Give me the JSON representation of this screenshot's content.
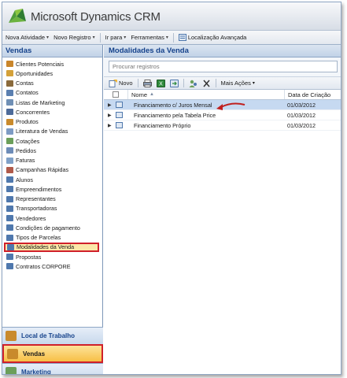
{
  "app": {
    "title": "Microsoft Dynamics CRM"
  },
  "menubar": {
    "items": [
      {
        "label": "Nova Atividade",
        "has_dropdown": true
      },
      {
        "label": "Novo Registro",
        "has_dropdown": true
      },
      {
        "label": "Ir para",
        "has_dropdown": true
      },
      {
        "label": "Ferramentas",
        "has_dropdown": true
      },
      {
        "label": "Localização Avançada",
        "has_dropdown": false
      }
    ]
  },
  "leftnav": {
    "header": "Vendas",
    "items": [
      {
        "label": "Clientes Potenciais",
        "icon": "leads-icon",
        "color": "#c9862c"
      },
      {
        "label": "Oportunidades",
        "icon": "opportunities-icon",
        "color": "#d4a13a"
      },
      {
        "label": "Contas",
        "icon": "accounts-icon",
        "color": "#8a6a3c"
      },
      {
        "label": "Contatos",
        "icon": "contacts-icon",
        "color": "#5a7fb0"
      },
      {
        "label": "Listas de Marketing",
        "icon": "marketing-lists-icon",
        "color": "#6f8fb5"
      },
      {
        "label": "Concorrentes",
        "icon": "competitors-icon",
        "color": "#4d6b9a"
      },
      {
        "label": "Produtos",
        "icon": "products-icon",
        "color": "#c98a2c"
      },
      {
        "label": "Literatura de Vendas",
        "icon": "sales-literature-icon",
        "color": "#7d9bc4"
      },
      {
        "label": "Cotações",
        "icon": "quotes-icon",
        "color": "#6b9f5a"
      },
      {
        "label": "Pedidos",
        "icon": "orders-icon",
        "color": "#6d8cb8"
      },
      {
        "label": "Faturas",
        "icon": "invoices-icon",
        "color": "#7fa0c7"
      },
      {
        "label": "Campanhas Rápidas",
        "icon": "quick-campaigns-icon",
        "color": "#b05a4a"
      },
      {
        "label": "Alunos",
        "icon": "students-icon",
        "color": "#4f78ad"
      },
      {
        "label": "Empreendimentos",
        "icon": "ventures-icon",
        "color": "#4f78ad"
      },
      {
        "label": "Representantes",
        "icon": "representatives-icon",
        "color": "#4f78ad"
      },
      {
        "label": "Transportadoras",
        "icon": "carriers-icon",
        "color": "#4f78ad"
      },
      {
        "label": "Vendedores",
        "icon": "sellers-icon",
        "color": "#4f78ad"
      },
      {
        "label": "Condições de pagamento",
        "icon": "payment-terms-icon",
        "color": "#4f78ad"
      },
      {
        "label": "Tipos de Parcelas",
        "icon": "installment-types-icon",
        "color": "#4f78ad"
      },
      {
        "label": "Modalidades da Venda",
        "icon": "sale-modalities-icon",
        "color": "#4f78ad",
        "selected": true
      },
      {
        "label": "Propostas",
        "icon": "proposals-icon",
        "color": "#4f78ad"
      },
      {
        "label": "Contratos CORPORE",
        "icon": "contracts-icon",
        "color": "#4f78ad"
      }
    ]
  },
  "wunderbar": {
    "items": [
      {
        "label": "Local de Trabalho",
        "icon": "workplace-icon",
        "color": "#c98a2c"
      },
      {
        "label": "Vendas",
        "icon": "sales-icon",
        "color": "#c98a2c",
        "active": true
      },
      {
        "label": "Marketing",
        "icon": "marketing-icon",
        "color": "#6b9f5a"
      }
    ]
  },
  "content": {
    "title": "Modalidades da Venda",
    "search": {
      "placeholder": "Procurar registros"
    },
    "toolbar": {
      "new_label": "Novo",
      "more_actions_label": "Mais Ações"
    },
    "columns": {
      "name": "Nome",
      "date": "Data de Criação"
    },
    "rows": [
      {
        "name": "Financiamento c/ Juros Mensal",
        "date": "01/03/2012",
        "selected": true
      },
      {
        "name": "Financiamento pela Tabela Price",
        "date": "01/03/2012",
        "selected": false
      },
      {
        "name": "Financiamento Próprio",
        "date": "01/03/2012",
        "selected": false
      }
    ]
  },
  "colors": {
    "brand_blue": "#15428b",
    "highlight_red": "#d0202a",
    "selected_row": "#c6d9f1",
    "selected_nav": "#fbe7a8"
  }
}
